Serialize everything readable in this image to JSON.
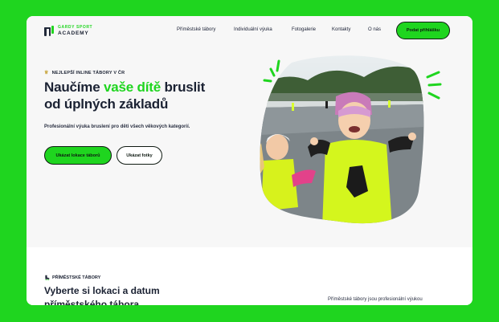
{
  "brand": {
    "line1": "GARDY SPORT",
    "line2": "ACADEMY"
  },
  "nav": {
    "items": [
      "Příměstské tábory",
      "Individuální výuka",
      "Fotogalerie",
      "Kontakty",
      "O nás"
    ],
    "cta": "Podat přihlášku"
  },
  "hero": {
    "eyebrow": "NEJLEPŠÍ INLINE TÁBORY V ČR",
    "title_part1": "Naučíme ",
    "title_highlight": "vaše dítě",
    "title_part2": " bruslit",
    "title_line2": "od úplných základů",
    "subtitle": "Profesionální výuka bruslení pro děti všech věkových kategorií.",
    "primary_button": "Ukázat lokace táborů",
    "secondary_button": "Ukázat fotky"
  },
  "section": {
    "eyebrow": "PŘÍMĚSTSKÉ TÁBORY",
    "title_line1": "Vyberte si lokaci a datum",
    "title_line2": "příměstského tábora",
    "right_text": "Příměstské tábory jsou profesionální výukou"
  },
  "colors": {
    "accent": "#1fd51f",
    "dark": "#1b2233",
    "background": "#1fd51f"
  },
  "icons": [
    "logo-icon",
    "trophy-icon",
    "inline-skate-icon",
    "hero-photo",
    "sparkle-lines"
  ]
}
